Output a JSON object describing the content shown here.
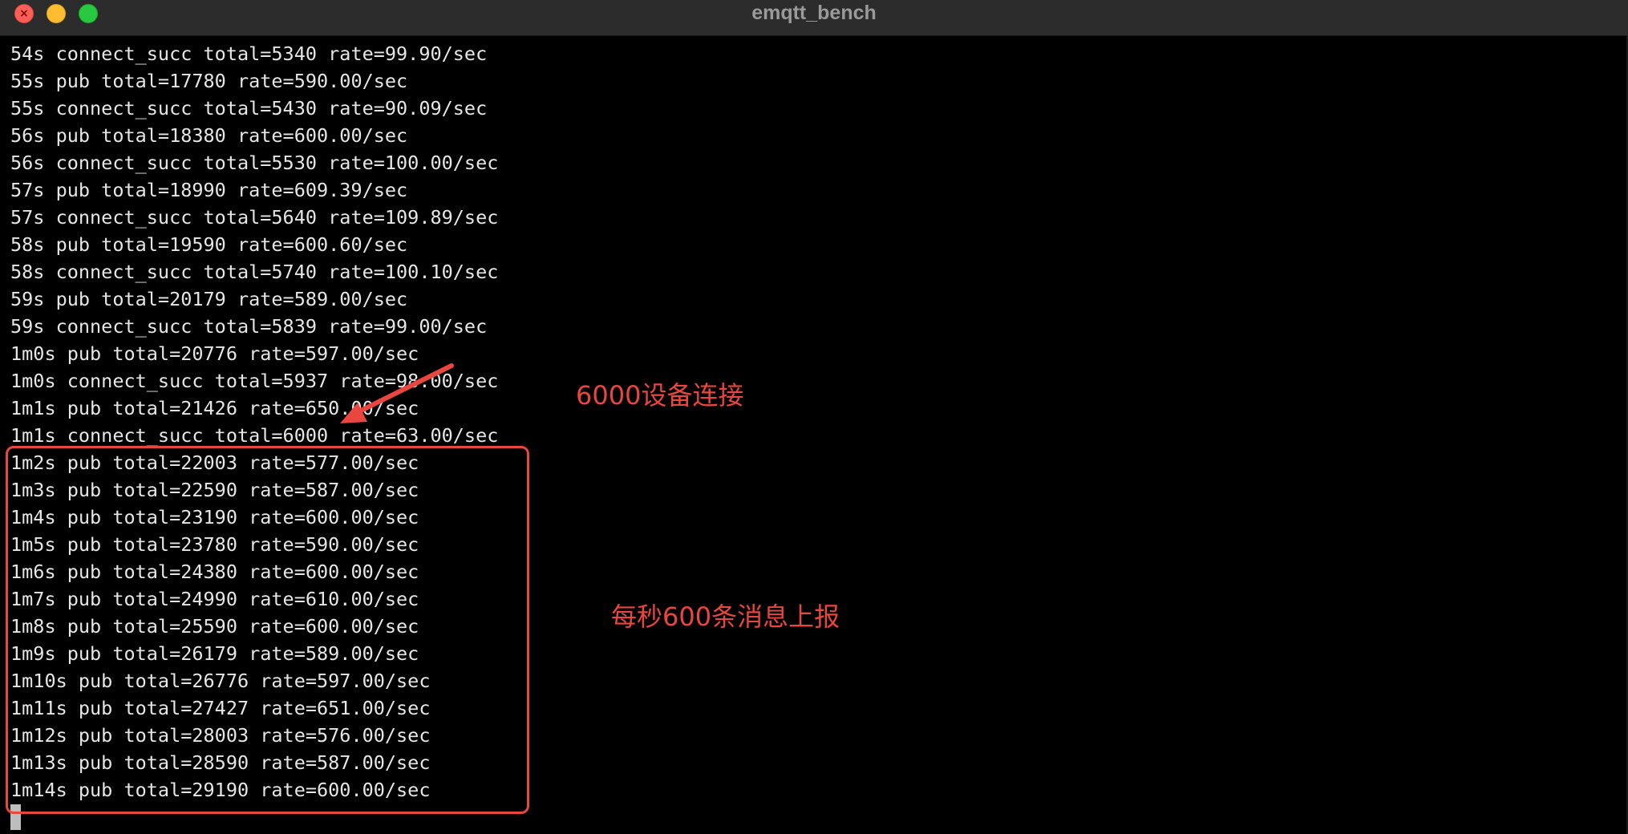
{
  "window": {
    "title": "emqtt_bench",
    "close_glyph": "×"
  },
  "terminal": {
    "lines": [
      "54s connect_succ total=5340 rate=99.90/sec",
      "55s pub total=17780 rate=590.00/sec",
      "55s connect_succ total=5430 rate=90.09/sec",
      "56s pub total=18380 rate=600.00/sec",
      "56s connect_succ total=5530 rate=100.00/sec",
      "57s pub total=18990 rate=609.39/sec",
      "57s connect_succ total=5640 rate=109.89/sec",
      "58s pub total=19590 rate=600.60/sec",
      "58s connect_succ total=5740 rate=100.10/sec",
      "59s pub total=20179 rate=589.00/sec",
      "59s connect_succ total=5839 rate=99.00/sec",
      "1m0s pub total=20776 rate=597.00/sec",
      "1m0s connect_succ total=5937 rate=98.00/sec",
      "1m1s pub total=21426 rate=650.00/sec",
      "1m1s connect_succ total=6000 rate=63.00/sec",
      "1m2s pub total=22003 rate=577.00/sec",
      "1m3s pub total=22590 rate=587.00/sec",
      "1m4s pub total=23190 rate=600.00/sec",
      "1m5s pub total=23780 rate=590.00/sec",
      "1m6s pub total=24380 rate=600.00/sec",
      "1m7s pub total=24990 rate=610.00/sec",
      "1m8s pub total=25590 rate=600.00/sec",
      "1m9s pub total=26179 rate=589.00/sec",
      "1m10s pub total=26776 rate=597.00/sec",
      "1m11s pub total=27427 rate=651.00/sec",
      "1m12s pub total=28003 rate=576.00/sec",
      "1m13s pub total=28590 rate=587.00/sec",
      "1m14s pub total=29190 rate=600.00/sec"
    ]
  },
  "annotations": {
    "connections": "6000设备连接",
    "messages": "每秒600条消息上报",
    "color": "#e8463f"
  },
  "colors": {
    "background": "#000000",
    "text": "#e6e6e6",
    "titlebar": "#2c2c2c",
    "close": "#ff5f57",
    "minimize": "#febc2e",
    "maximize": "#28c840"
  },
  "icons": {
    "close": "close-icon",
    "minimize": "minimize-icon",
    "maximize": "maximize-icon",
    "arrow": "arrow-icon"
  }
}
